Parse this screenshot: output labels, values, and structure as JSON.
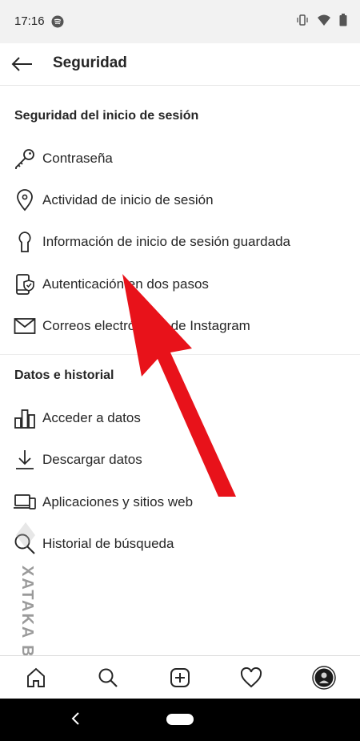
{
  "status": {
    "time": "17:16"
  },
  "header": {
    "title": "Seguridad"
  },
  "login_section": {
    "title": "Seguridad del inicio de sesión",
    "items": [
      {
        "label": "Contraseña",
        "icon": "key-icon"
      },
      {
        "label": "Actividad de inicio de sesión",
        "icon": "location-pin-icon"
      },
      {
        "label": "Información de inicio de sesión guardada",
        "icon": "keyhole-icon"
      },
      {
        "label": "Autenticación en dos pasos",
        "icon": "phone-shield-icon"
      },
      {
        "label": "Correos electrónicos de Instagram",
        "icon": "envelope-icon"
      }
    ]
  },
  "data_section": {
    "title": "Datos e historial",
    "items": [
      {
        "label": "Acceder a datos",
        "icon": "bar-chart-icon"
      },
      {
        "label": "Descargar datos",
        "icon": "download-icon"
      },
      {
        "label": "Aplicaciones y sitios web",
        "icon": "devices-icon"
      },
      {
        "label": "Historial de búsqueda",
        "icon": "search-icon"
      }
    ]
  },
  "watermark": {
    "text": "XATAKA BASICS"
  },
  "colors": {
    "arrow": "#e8121a",
    "text": "#262626",
    "divider": "#ececec"
  }
}
